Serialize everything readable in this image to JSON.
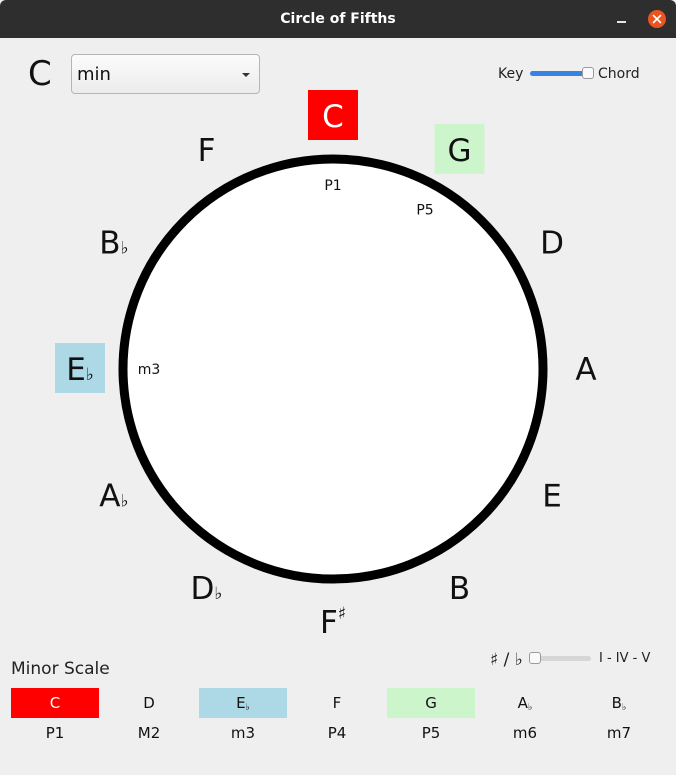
{
  "window": {
    "title": "Circle of Fifths"
  },
  "header": {
    "root_note": "C",
    "mode_value": "min",
    "mode_toggle": {
      "left_label": "Key",
      "right_label": "Chord",
      "value": 1
    }
  },
  "circle": {
    "notes": [
      {
        "id": "C",
        "label": "C",
        "accidental": "",
        "highlight": "#ff0000",
        "text_color": "#ffffff",
        "interval": "P1"
      },
      {
        "id": "G",
        "label": "G",
        "accidental": "",
        "highlight": "#ccf5cc",
        "text_color": "#111111",
        "interval": "P5"
      },
      {
        "id": "D",
        "label": "D",
        "accidental": "",
        "highlight": "",
        "text_color": "#111111",
        "interval": ""
      },
      {
        "id": "A",
        "label": "A",
        "accidental": "",
        "highlight": "",
        "text_color": "#111111",
        "interval": ""
      },
      {
        "id": "E",
        "label": "E",
        "accidental": "",
        "highlight": "",
        "text_color": "#111111",
        "interval": ""
      },
      {
        "id": "B",
        "label": "B",
        "accidental": "",
        "highlight": "",
        "text_color": "#111111",
        "interval": ""
      },
      {
        "id": "Fs",
        "label": "F",
        "accidental": "♯",
        "highlight": "",
        "text_color": "#111111",
        "interval": ""
      },
      {
        "id": "Db",
        "label": "D",
        "accidental": "♭",
        "highlight": "",
        "text_color": "#111111",
        "interval": ""
      },
      {
        "id": "Ab",
        "label": "A",
        "accidental": "♭",
        "highlight": "",
        "text_color": "#111111",
        "interval": ""
      },
      {
        "id": "Eb",
        "label": "E",
        "accidental": "♭",
        "highlight": "#add8e6",
        "text_color": "#111111",
        "interval": "m3"
      },
      {
        "id": "Bb",
        "label": "B",
        "accidental": "♭",
        "highlight": "",
        "text_color": "#111111",
        "interval": ""
      },
      {
        "id": "F",
        "label": "F",
        "accidental": "",
        "highlight": "",
        "text_color": "#111111",
        "interval": ""
      }
    ]
  },
  "controls": {
    "accidental_toggle": {
      "left_label": "♯ / ♭",
      "right_label": "I - IV - V",
      "value": 0
    }
  },
  "scale": {
    "title": "Minor Scale",
    "degrees": [
      {
        "note": "C",
        "accidental": "",
        "interval": "P1",
        "highlight": "#ff0000",
        "text_color": "#ffffff"
      },
      {
        "note": "D",
        "accidental": "",
        "interval": "M2",
        "highlight": "",
        "text_color": "#111111"
      },
      {
        "note": "E",
        "accidental": "♭",
        "interval": "m3",
        "highlight": "#add8e6",
        "text_color": "#111111"
      },
      {
        "note": "F",
        "accidental": "",
        "interval": "P4",
        "highlight": "",
        "text_color": "#111111"
      },
      {
        "note": "G",
        "accidental": "",
        "interval": "P5",
        "highlight": "#ccf5cc",
        "text_color": "#111111"
      },
      {
        "note": "A",
        "accidental": "♭",
        "interval": "m6",
        "highlight": "",
        "text_color": "#111111"
      },
      {
        "note": "B",
        "accidental": "♭",
        "interval": "m7",
        "highlight": "",
        "text_color": "#111111"
      }
    ]
  },
  "colors": {
    "accent": "#3584e4",
    "window_bg": "#efefef",
    "titlebar": "#2e2e2e",
    "close": "#e95420"
  }
}
